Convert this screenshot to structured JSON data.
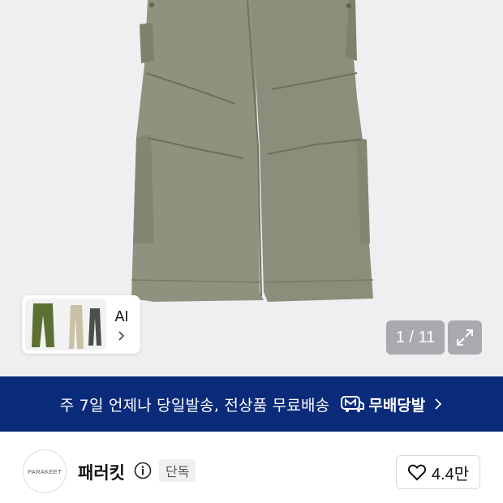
{
  "gallery": {
    "counter_text": "1 / 11"
  },
  "variants": {
    "ai_label": "AI"
  },
  "banner": {
    "text": "주 7일 언제나 당일발송, 전상품 무료배송",
    "brand_label": "무배당발",
    "background_color": "#0a2a7a"
  },
  "seller": {
    "avatar_text": "PARAKEET",
    "name": "패러킷",
    "badge": "단독",
    "likes": "4.4만"
  },
  "icons": {
    "expand": "expand-icon",
    "chevron": "chevron-right-icon",
    "info": "info-icon",
    "heart": "heart-icon",
    "delivery_badge": "delivery-m-icon"
  }
}
